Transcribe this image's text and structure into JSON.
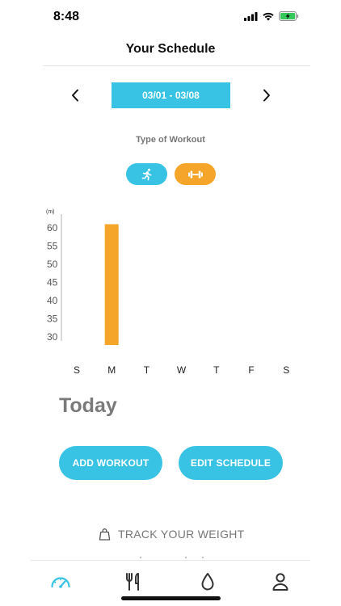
{
  "status_bar": {
    "time": "8:48"
  },
  "header": {
    "title": "Your Schedule"
  },
  "week": {
    "range": "03/01 - 03/08"
  },
  "workout_type": {
    "label": "Type of Workout",
    "types": [
      {
        "name": "running",
        "icon": "running-icon",
        "color": "#38c3e4"
      },
      {
        "name": "weights",
        "icon": "dumbbell-icon",
        "color": "#f4a52a"
      }
    ]
  },
  "chart_data": {
    "type": "bar",
    "ylabel": "(m)",
    "categories": [
      "S",
      "M",
      "T",
      "W",
      "T",
      "F",
      "S"
    ],
    "yticks": [
      "60",
      "55",
      "50",
      "45",
      "40",
      "35",
      "30"
    ],
    "ylim": [
      28,
      64
    ],
    "values": [
      null,
      61,
      null,
      null,
      null,
      null,
      null
    ],
    "bar_color": "#f4a52a",
    "grid": false
  },
  "today": {
    "title": "Today"
  },
  "actions": {
    "add_workout": "ADD WORKOUT",
    "edit_schedule": "EDIT SCHEDULE"
  },
  "track_weight": {
    "label": "TRACK YOUR WEIGHT"
  },
  "tab_bar": {
    "tabs": [
      {
        "icon": "speedometer-icon",
        "active": true
      },
      {
        "icon": "fork-knife-icon",
        "active": false
      },
      {
        "icon": "water-drop-icon",
        "active": false
      },
      {
        "icon": "profile-icon",
        "active": false
      }
    ]
  },
  "colors": {
    "accent": "#38c3e4",
    "weights": "#f4a52a",
    "text_muted": "#777777"
  }
}
